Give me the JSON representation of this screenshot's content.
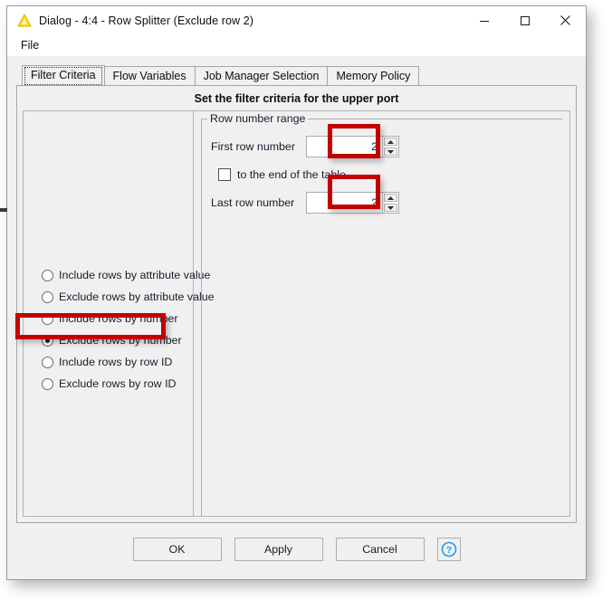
{
  "window": {
    "title": "Dialog - 4:4 - Row Splitter (Exclude row 2)",
    "app_icon": "knime-triangle-icon",
    "controls": {
      "minimize": "minimize-icon",
      "maximize": "maximize-icon",
      "close": "close-icon"
    }
  },
  "menubar": {
    "items": [
      {
        "label": "File"
      }
    ]
  },
  "tabs": [
    {
      "label": "Filter Criteria",
      "selected": true
    },
    {
      "label": "Flow Variables",
      "selected": false
    },
    {
      "label": "Job Manager Selection",
      "selected": false
    },
    {
      "label": "Memory Policy",
      "selected": false
    }
  ],
  "panel": {
    "heading": "Set the filter criteria for the upper port"
  },
  "filter_modes": [
    {
      "label": "Include rows by attribute value",
      "selected": false
    },
    {
      "label": "Exclude rows by attribute value",
      "selected": false
    },
    {
      "label": "Include rows by number",
      "selected": false
    },
    {
      "label": "Exclude rows by number",
      "selected": true
    },
    {
      "label": "Include rows by row ID",
      "selected": false
    },
    {
      "label": "Exclude rows by row ID",
      "selected": false
    }
  ],
  "row_number_range": {
    "group_title": "Row number range",
    "first_row": {
      "label": "First row number",
      "value": "2"
    },
    "to_end": {
      "label": "to the end of the table",
      "checked": false
    },
    "last_row": {
      "label": "Last row number",
      "value": "2"
    }
  },
  "footer": {
    "ok": "OK",
    "apply": "Apply",
    "cancel": "Cancel",
    "help": "help-icon"
  },
  "annotations": {
    "accent_color": "#c30000",
    "boxes": [
      {
        "target": "first-row-spinner"
      },
      {
        "target": "last-row-spinner"
      },
      {
        "target": "exclude-rows-by-number-radio"
      }
    ]
  }
}
